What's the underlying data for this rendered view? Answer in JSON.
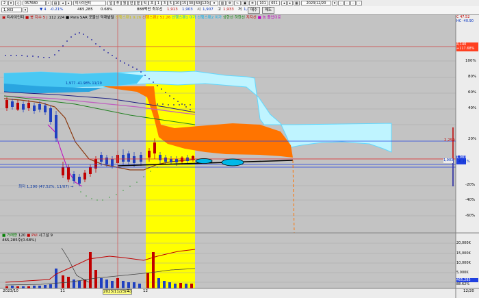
{
  "toolbar": {
    "dropdown_label": "2",
    "code": "057680",
    "stock_name": "티사이언티",
    "period_buttons": [
      "1",
      "3",
      "5",
      "10",
      "15",
      "30",
      "60",
      "120"
    ],
    "count": "101",
    "max": "651",
    "date": "2023/12/20",
    "trade_icons": [
      "-",
      "-",
      "-",
      "-"
    ]
  },
  "quote": {
    "price": "1,903",
    "change": "4",
    "change_pct": "-0.21%",
    "volume": "465,285",
    "turnover": "0.68%",
    "amount_label": "888백만 최우선",
    "high": "1,913",
    "ask": "1,903",
    "open_label": "시",
    "open": "1,907",
    "high_label": "고",
    "high_val": "1,933",
    "low_label": "저",
    "low_val": "1,878",
    "buy_button": "매수",
    "sell_button": "매도"
  },
  "price_panel": {
    "legend": [
      {
        "text": "티사이언티",
        "color": "#000000"
      },
      {
        "text": "■ 봉 지수 5 |",
        "color": "#c00000"
      },
      {
        "text": "112 224",
        "color": "#000000"
      },
      {
        "text": "■ Para SAR 포물선",
        "color": "#000000"
      },
      {
        "text": "덕재밭탈",
        "color": "#000000"
      },
      {
        "text": "선행스팬1 9.26",
        "color": "#d0c000"
      },
      {
        "text": "선행스팬2 52.26",
        "color": "#e06000"
      },
      {
        "text": "선행스팬1 이가",
        "color": "#00b0f0"
      },
      {
        "text": "선행스팬2 이가",
        "color": "#00b0f0"
      },
      {
        "text": "상한선",
        "color": "#008000"
      },
      {
        "text": "하한선",
        "color": "#008000"
      },
      {
        "text": "지지선",
        "color": "#c00000"
      },
      {
        "text": "■ 놈 졸업이로",
        "color": "#c000c0"
      }
    ],
    "axis_ticks": [
      "100%",
      "80%",
      "60%",
      "40%",
      "20%",
      "-20%",
      "-40%",
      "-60%"
    ],
    "corner_labels": [
      "C 47.52",
      "HC -40.90"
    ],
    "flag_top": {
      "line1": "4,140",
      "line2": "+117.68%"
    },
    "flag_20": "2,259",
    "flag_current": {
      "line1": "1,983",
      "line2": "-0.21%"
    },
    "flag_mid": "1,903",
    "low_annotation": "최저 1,290 (47.52%, 11/07) →",
    "ma_annotation": "1,977 -41.98% 11/20"
  },
  "volume_panel": {
    "legend": [
      {
        "text": "■ 거래량",
        "color": "#008000"
      },
      {
        "text": "120",
        "color": "#000000"
      },
      {
        "text": "■ PVI",
        "color": "#c00000"
      },
      {
        "text": "시그널 9",
        "color": "#000000"
      }
    ],
    "subtitle": "465,285주(0.68%)",
    "axis_ticks": [
      "20,000K",
      "15,000K",
      "10,000K",
      "5,000K"
    ],
    "flags": [
      "465,285",
      "88.62%"
    ]
  },
  "date_axis": {
    "labels": [
      "2023/10",
      "11",
      "12",
      "12/20"
    ],
    "selected": "2023/11/23(목)"
  }
}
